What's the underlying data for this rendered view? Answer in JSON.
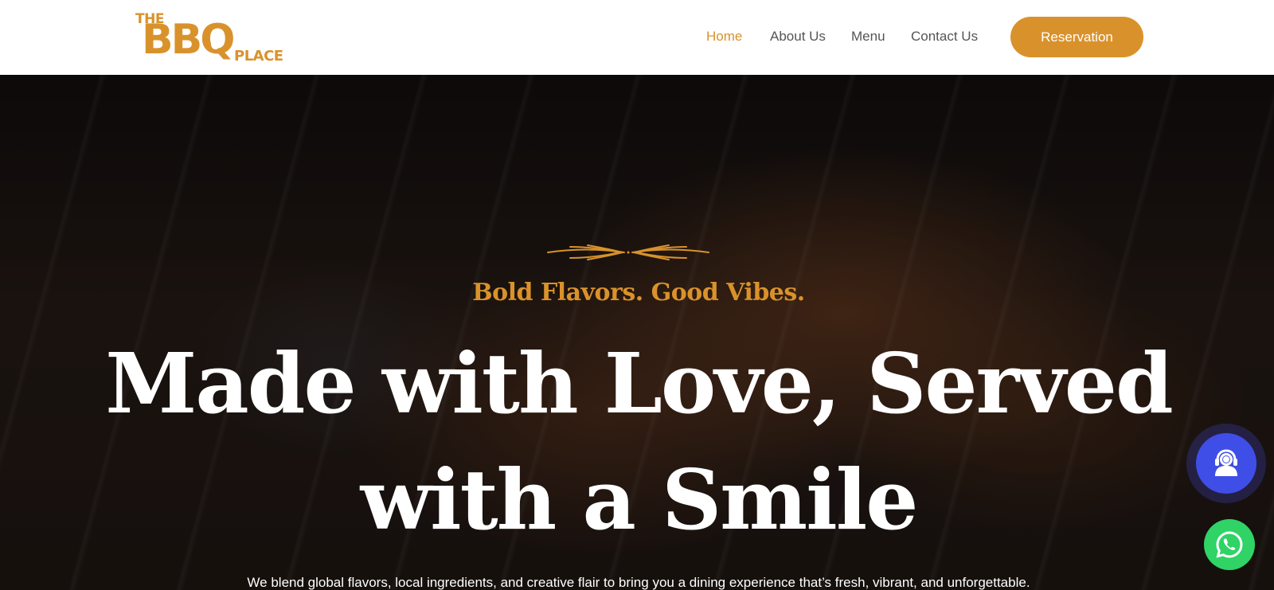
{
  "header": {
    "logo": {
      "the": "THE",
      "bbq": "BBQ",
      "place": "PLACE"
    },
    "nav": [
      {
        "label": "Home",
        "active": true
      },
      {
        "label": "About Us",
        "active": false
      },
      {
        "label": "Menu",
        "active": false
      },
      {
        "label": "Contact Us",
        "active": false
      }
    ],
    "cta_label": "Reservation"
  },
  "hero": {
    "tagline": "Bold Flavors. Good Vibes.",
    "headline_line1": "Made with Love, Served",
    "headline_line2": "with a Smile",
    "subtext": "We blend global flavors, local ingredients, and creative flair to bring you a dining experience that’s fresh, vibrant, and unforgettable."
  },
  "floating": {
    "support_icon": "support-agent-icon",
    "whatsapp_icon": "whatsapp-icon"
  },
  "colors": {
    "accent": "#d9922b",
    "nav_text": "#555555",
    "support": "#3f4ee6",
    "whatsapp": "#2fd366"
  }
}
